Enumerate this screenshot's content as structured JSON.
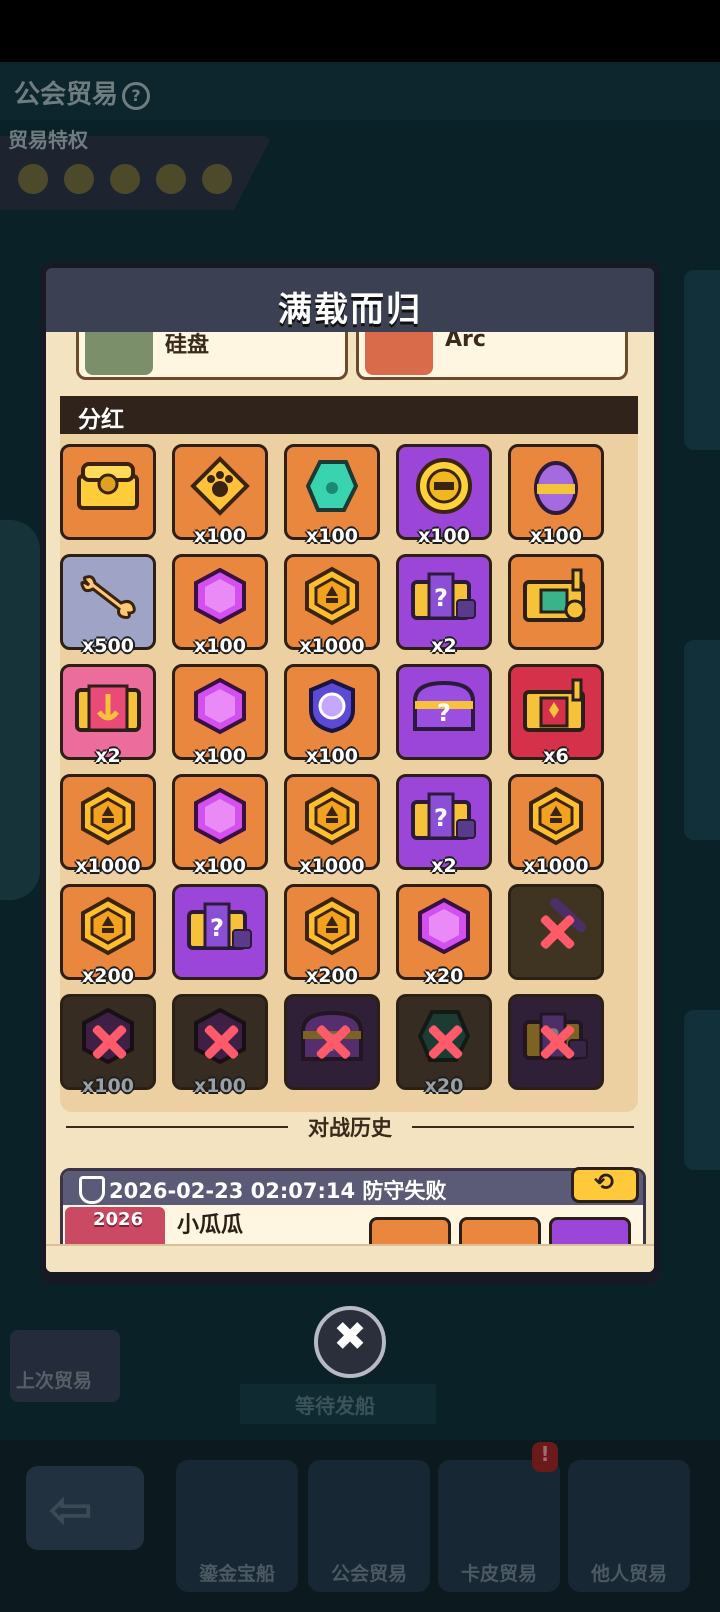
{
  "background": {
    "title": "公会贸易",
    "help_icon": "?",
    "privilege_label": "贸易特权",
    "wait_label": "等待发船",
    "last_trade_label": "上次贸易",
    "badge": "!",
    "tabs": [
      {
        "label": "鎏金宝船"
      },
      {
        "label": "公会贸易"
      },
      {
        "label": "卡皮贸易"
      },
      {
        "label": "他人贸易"
      }
    ]
  },
  "modal": {
    "title": "满载而归",
    "top_cards": [
      {
        "name": "硅盘"
      },
      {
        "name": "Arc"
      }
    ],
    "section_title": "分红",
    "rewards": [
      {
        "icon": "golden-chest-icon",
        "bg": "#e9873f",
        "qty": "",
        "claimed": false
      },
      {
        "icon": "paw-emblem-icon",
        "bg": "#e9873f",
        "qty": "x100",
        "claimed": false
      },
      {
        "icon": "green-paw-gem-icon",
        "bg": "#e9873f",
        "qty": "x100",
        "claimed": false
      },
      {
        "icon": "gold-coin-icon",
        "bg": "#9b45d9",
        "qty": "x100",
        "claimed": false
      },
      {
        "icon": "purple-egg-icon",
        "bg": "#e9873f",
        "qty": "x100",
        "claimed": false
      },
      {
        "icon": "bone-icon",
        "bg": "#9fa4c7",
        "qty": "x500",
        "claimed": false
      },
      {
        "icon": "purple-gem-icon",
        "bg": "#e9873f",
        "qty": "x100",
        "claimed": false
      },
      {
        "icon": "gold-hex-token-icon",
        "bg": "#e9873f",
        "qty": "x1000",
        "claimed": false
      },
      {
        "icon": "mystery-chest-icon",
        "bg": "#9b45d9",
        "qty": "x2",
        "claimed": false
      },
      {
        "icon": "key-chest-icon",
        "bg": "#e9873f",
        "qty": "",
        "claimed": false
      },
      {
        "icon": "anchor-chest-icon",
        "bg": "#ec6d9c",
        "qty": "x2",
        "claimed": false
      },
      {
        "icon": "purple-gem-icon",
        "bg": "#e9873f",
        "qty": "x100",
        "claimed": false
      },
      {
        "icon": "purple-shield-orb-icon",
        "bg": "#e9873f",
        "qty": "x100",
        "claimed": false
      },
      {
        "icon": "purple-mystery-chest-icon",
        "bg": "#9b45d9",
        "qty": "",
        "claimed": false
      },
      {
        "icon": "trophy-chest-icon",
        "bg": "#d6314b",
        "qty": "x6",
        "claimed": false
      },
      {
        "icon": "gold-hex-token-icon",
        "bg": "#e9873f",
        "qty": "x1000",
        "claimed": false
      },
      {
        "icon": "purple-gem-icon",
        "bg": "#e9873f",
        "qty": "x100",
        "claimed": false
      },
      {
        "icon": "gold-hex-token-icon",
        "bg": "#e9873f",
        "qty": "x1000",
        "claimed": false
      },
      {
        "icon": "mystery-chest-icon",
        "bg": "#9b45d9",
        "qty": "x2",
        "claimed": false
      },
      {
        "icon": "gold-hex-token-icon",
        "bg": "#e9873f",
        "qty": "x1000",
        "claimed": false
      },
      {
        "icon": "gold-hex-token-icon",
        "bg": "#e9873f",
        "qty": "x200",
        "claimed": false
      },
      {
        "icon": "mystery-chest-icon",
        "bg": "#9b45d9",
        "qty": "",
        "claimed": false
      },
      {
        "icon": "gold-hex-token-icon",
        "bg": "#e9873f",
        "qty": "x200",
        "claimed": false
      },
      {
        "icon": "purple-gem-icon",
        "bg": "#e9873f",
        "qty": "x20",
        "claimed": false
      },
      {
        "icon": "pickaxe-icon",
        "bg": "#6d5a3a",
        "qty": "",
        "claimed": true
      },
      {
        "icon": "dark-purple-gem-icon",
        "bg": "#5a4a3a",
        "qty": "x100",
        "claimed": true
      },
      {
        "icon": "dark-purple-gem-icon",
        "bg": "#5a4a3a",
        "qty": "x100",
        "claimed": true
      },
      {
        "icon": "purple-mystery-chest-icon",
        "bg": "#4a2f6a",
        "qty": "",
        "claimed": true
      },
      {
        "icon": "teal-gem-icon",
        "bg": "#5a4a3a",
        "qty": "x20",
        "claimed": true
      },
      {
        "icon": "mystery-chest-icon",
        "bg": "#4a2f6a",
        "qty": "",
        "claimed": true
      }
    ],
    "history_label": "对战历史",
    "history": {
      "text": "2026-02-23 02:07:14 防守失败",
      "avatar_badge": "2026",
      "player_name": "小瓜瓜",
      "replay_icon": "replay-icon"
    }
  },
  "close_icon": "close-icon"
}
